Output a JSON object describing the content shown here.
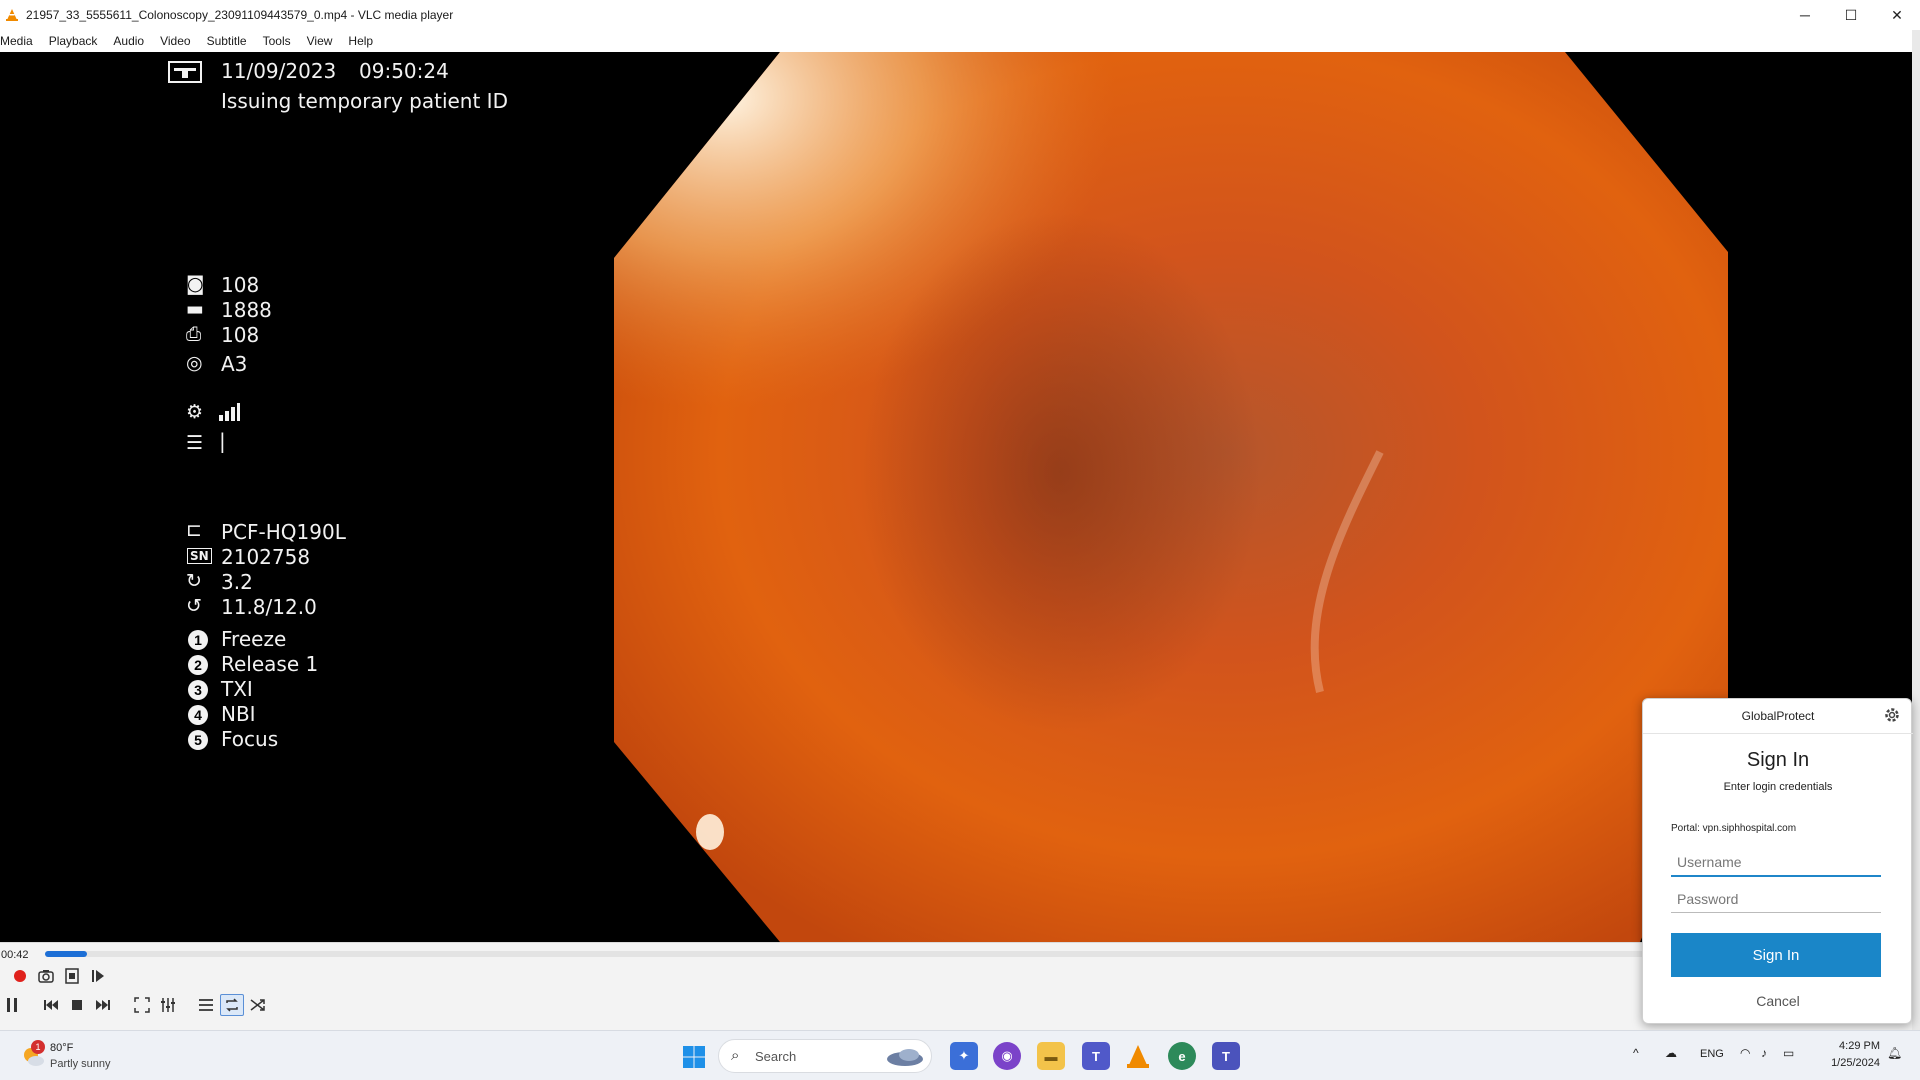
{
  "window": {
    "title": "21957_33_5555611_Colonoscopy_23091109443579_0.mp4 - VLC media player",
    "minimize_glyph": "─",
    "maximize_glyph": "☐",
    "close_glyph": "✕"
  },
  "menu": [
    "Media",
    "Playback",
    "Audio",
    "Video",
    "Subtitle",
    "Tools",
    "View",
    "Help"
  ],
  "overlay": {
    "date": "11/09/2023",
    "time": "09:50:24",
    "status": "Issuing temporary patient ID",
    "camera_count": "108",
    "battery_value": "1888",
    "cvp_value": "108",
    "mode": "A3",
    "text_cursor": "|",
    "scope_model": "PCF-HQ190L",
    "serial_label": "SN",
    "serial": "2102758",
    "value_a": "3.2",
    "value_b": "11.8/12.0",
    "buttons": [
      {
        "num": "1",
        "label": "Freeze"
      },
      {
        "num": "2",
        "label": "Release 1"
      },
      {
        "num": "3",
        "label": "TXI"
      },
      {
        "num": "4",
        "label": "NBI"
      },
      {
        "num": "5",
        "label": "Focus"
      }
    ]
  },
  "player": {
    "elapsed": "00:42",
    "progress_fraction": 0.026
  },
  "globalprotect": {
    "title": "GlobalProtect",
    "heading": "Sign In",
    "subheading": "Enter login credentials",
    "portal": "Portal: vpn.siphhospital.com",
    "username_placeholder": "Username",
    "password_placeholder": "Password",
    "signin_label": "Sign In",
    "cancel_label": "Cancel"
  },
  "taskbar": {
    "badge": "1",
    "temperature": "80°F",
    "condition": "Partly sunny",
    "search_placeholder": "Search",
    "language": "ENG",
    "time": "4:29 PM",
    "date": "1/25/2024"
  },
  "colors": {
    "seek_fill": "#1d6fd6",
    "signin_button": "#1a86c8",
    "record": "#e0211c"
  }
}
